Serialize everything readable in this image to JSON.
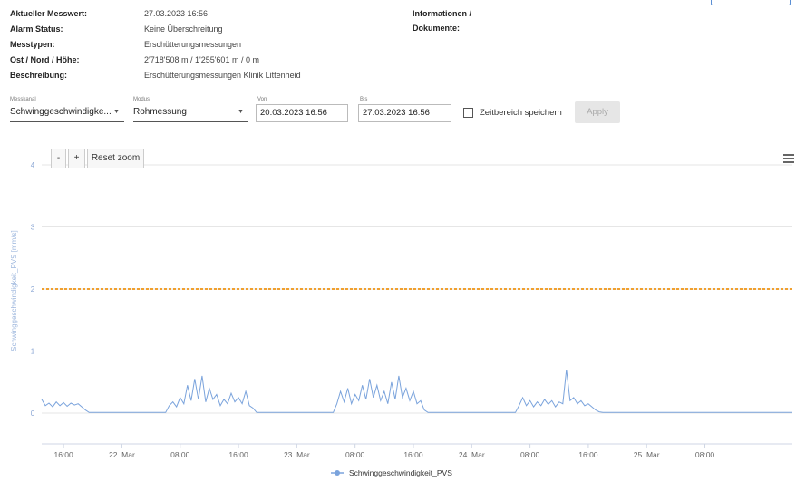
{
  "info": {
    "rows": [
      {
        "label": "Aktueller Messwert:",
        "value": "27.03.2023 16:56"
      },
      {
        "label": "Alarm Status:",
        "value": "Keine Überschreitung"
      },
      {
        "label": "Messtypen:",
        "value": "Erschütterungsmessungen"
      },
      {
        "label": "Ost / Nord / Höhe:",
        "value": "2'718'508 m / 1'255'601 m / 0 m"
      },
      {
        "label": "Beschreibung:",
        "value": "Erschütterungsmessungen Klinik Littenheid"
      }
    ],
    "documents_label_line1": "Informationen /",
    "documents_label_line2": "Dokumente:"
  },
  "controls": {
    "messkanal_label": "Messkanal",
    "messkanal_value": "Schwinggeschwindigke...",
    "modus_label": "Modus",
    "modus_value": "Rohmessung",
    "von_label": "Von",
    "von_value": "20.03.2023 16:56",
    "bis_label": "Bis",
    "bis_value": "27.03.2023 16:56",
    "save_range_label": "Zeitbereich speichern",
    "save_range_checked": false,
    "apply_label": "Apply"
  },
  "zoom": {
    "minus": "-",
    "plus": "+",
    "reset": "Reset zoom"
  },
  "colors": {
    "series": "#7aa3dc",
    "threshold": "#f0a030",
    "grid": "#e6e6e6",
    "axis_text": "#666666"
  },
  "chart_data": {
    "type": "line",
    "title": "",
    "xlabel": "",
    "ylabel": "Schwinggeschwindigkeit_PVS [mm/s]",
    "ylim": [
      0,
      4
    ],
    "yticks": [
      0,
      1,
      2,
      3,
      4
    ],
    "xlim": [
      "2023-03-21 13:00",
      "2023-03-25 20:00"
    ],
    "xticks": [
      {
        "t": "2023-03-21 16:00",
        "label": "16:00"
      },
      {
        "t": "2023-03-22 00:00",
        "label": "22. Mar"
      },
      {
        "t": "2023-03-22 08:00",
        "label": "08:00"
      },
      {
        "t": "2023-03-22 16:00",
        "label": "16:00"
      },
      {
        "t": "2023-03-23 00:00",
        "label": "23. Mar"
      },
      {
        "t": "2023-03-23 08:00",
        "label": "08:00"
      },
      {
        "t": "2023-03-23 16:00",
        "label": "16:00"
      },
      {
        "t": "2023-03-24 00:00",
        "label": "24. Mar"
      },
      {
        "t": "2023-03-24 08:00",
        "label": "08:00"
      },
      {
        "t": "2023-03-24 16:00",
        "label": "16:00"
      },
      {
        "t": "2023-03-25 00:00",
        "label": "25. Mar"
      },
      {
        "t": "2023-03-25 08:00",
        "label": "08:00"
      }
    ],
    "threshold": {
      "value": 2.0,
      "style": "dashed"
    },
    "legend_position": "bottom-center",
    "series": [
      {
        "name": "Schwinggeschwindigkeit_PVS",
        "points": [
          [
            "2023-03-21 13:00",
            0.22
          ],
          [
            "2023-03-21 13:30",
            0.12
          ],
          [
            "2023-03-21 14:00",
            0.16
          ],
          [
            "2023-03-21 14:30",
            0.1
          ],
          [
            "2023-03-21 15:00",
            0.18
          ],
          [
            "2023-03-21 15:30",
            0.12
          ],
          [
            "2023-03-21 16:00",
            0.17
          ],
          [
            "2023-03-21 16:30",
            0.11
          ],
          [
            "2023-03-21 17:00",
            0.16
          ],
          [
            "2023-03-21 17:30",
            0.13
          ],
          [
            "2023-03-21 18:00",
            0.15
          ],
          [
            "2023-03-21 18:30",
            0.1
          ],
          [
            "2023-03-21 19:00",
            0.05
          ],
          [
            "2023-03-21 19:30",
            0.01
          ],
          [
            "2023-03-22 06:00",
            0.01
          ],
          [
            "2023-03-22 06:30",
            0.12
          ],
          [
            "2023-03-22 07:00",
            0.18
          ],
          [
            "2023-03-22 07:30",
            0.1
          ],
          [
            "2023-03-22 08:00",
            0.25
          ],
          [
            "2023-03-22 08:30",
            0.15
          ],
          [
            "2023-03-22 09:00",
            0.45
          ],
          [
            "2023-03-22 09:30",
            0.2
          ],
          [
            "2023-03-22 10:00",
            0.55
          ],
          [
            "2023-03-22 10:30",
            0.22
          ],
          [
            "2023-03-22 11:00",
            0.6
          ],
          [
            "2023-03-22 11:30",
            0.18
          ],
          [
            "2023-03-22 12:00",
            0.4
          ],
          [
            "2023-03-22 12:30",
            0.22
          ],
          [
            "2023-03-22 13:00",
            0.3
          ],
          [
            "2023-03-22 13:30",
            0.12
          ],
          [
            "2023-03-22 14:00",
            0.22
          ],
          [
            "2023-03-22 14:30",
            0.15
          ],
          [
            "2023-03-22 15:00",
            0.32
          ],
          [
            "2023-03-22 15:30",
            0.18
          ],
          [
            "2023-03-22 16:00",
            0.25
          ],
          [
            "2023-03-22 16:30",
            0.15
          ],
          [
            "2023-03-22 17:00",
            0.35
          ],
          [
            "2023-03-22 17:30",
            0.12
          ],
          [
            "2023-03-22 18:00",
            0.08
          ],
          [
            "2023-03-22 18:30",
            0.01
          ],
          [
            "2023-03-23 05:00",
            0.01
          ],
          [
            "2023-03-23 05:30",
            0.15
          ],
          [
            "2023-03-23 06:00",
            0.35
          ],
          [
            "2023-03-23 06:30",
            0.18
          ],
          [
            "2023-03-23 07:00",
            0.4
          ],
          [
            "2023-03-23 07:30",
            0.15
          ],
          [
            "2023-03-23 08:00",
            0.3
          ],
          [
            "2023-03-23 08:30",
            0.2
          ],
          [
            "2023-03-23 09:00",
            0.45
          ],
          [
            "2023-03-23 09:30",
            0.22
          ],
          [
            "2023-03-23 10:00",
            0.55
          ],
          [
            "2023-03-23 10:30",
            0.25
          ],
          [
            "2023-03-23 11:00",
            0.45
          ],
          [
            "2023-03-23 11:30",
            0.2
          ],
          [
            "2023-03-23 12:00",
            0.35
          ],
          [
            "2023-03-23 12:30",
            0.15
          ],
          [
            "2023-03-23 13:00",
            0.5
          ],
          [
            "2023-03-23 13:30",
            0.22
          ],
          [
            "2023-03-23 14:00",
            0.6
          ],
          [
            "2023-03-23 14:30",
            0.25
          ],
          [
            "2023-03-23 15:00",
            0.4
          ],
          [
            "2023-03-23 15:30",
            0.2
          ],
          [
            "2023-03-23 16:00",
            0.35
          ],
          [
            "2023-03-23 16:30",
            0.15
          ],
          [
            "2023-03-23 17:00",
            0.2
          ],
          [
            "2023-03-23 17:30",
            0.05
          ],
          [
            "2023-03-23 18:00",
            0.01
          ],
          [
            "2023-03-24 06:00",
            0.01
          ],
          [
            "2023-03-24 06:30",
            0.12
          ],
          [
            "2023-03-24 07:00",
            0.25
          ],
          [
            "2023-03-24 07:30",
            0.12
          ],
          [
            "2023-03-24 08:00",
            0.2
          ],
          [
            "2023-03-24 08:30",
            0.1
          ],
          [
            "2023-03-24 09:00",
            0.18
          ],
          [
            "2023-03-24 09:30",
            0.12
          ],
          [
            "2023-03-24 10:00",
            0.22
          ],
          [
            "2023-03-24 10:30",
            0.14
          ],
          [
            "2023-03-24 11:00",
            0.2
          ],
          [
            "2023-03-24 11:30",
            0.1
          ],
          [
            "2023-03-24 12:00",
            0.18
          ],
          [
            "2023-03-24 12:30",
            0.15
          ],
          [
            "2023-03-24 13:00",
            0.7
          ],
          [
            "2023-03-24 13:30",
            0.2
          ],
          [
            "2023-03-24 14:00",
            0.25
          ],
          [
            "2023-03-24 14:30",
            0.15
          ],
          [
            "2023-03-24 15:00",
            0.2
          ],
          [
            "2023-03-24 15:30",
            0.12
          ],
          [
            "2023-03-24 16:00",
            0.15
          ],
          [
            "2023-03-24 16:30",
            0.1
          ],
          [
            "2023-03-24 17:00",
            0.05
          ],
          [
            "2023-03-24 17:30",
            0.02
          ],
          [
            "2023-03-24 18:00",
            0.01
          ],
          [
            "2023-03-25 20:00",
            0.01
          ]
        ]
      }
    ]
  }
}
